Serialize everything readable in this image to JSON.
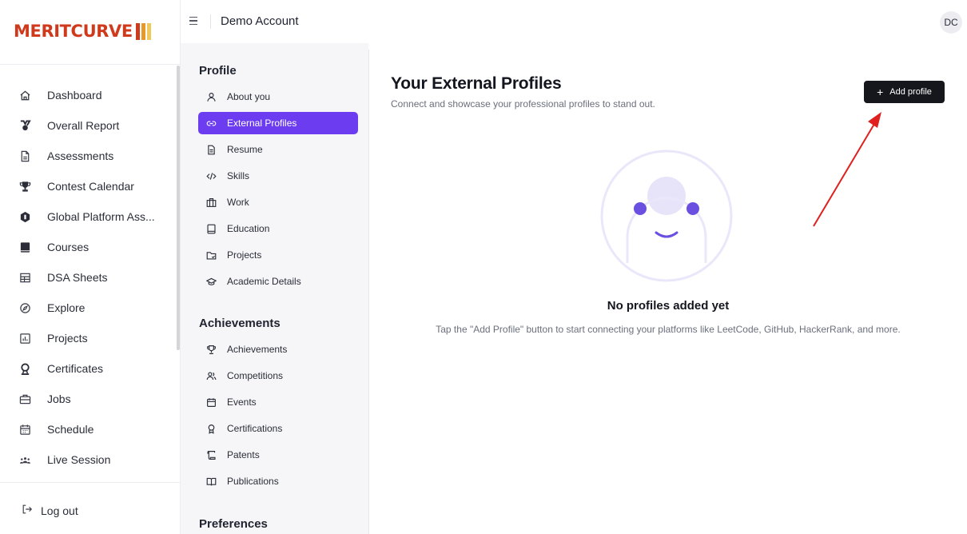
{
  "brand": {
    "name": "MERITCURVE"
  },
  "header": {
    "title": "Demo Account",
    "avatar_initials": "DC"
  },
  "sidebar": {
    "items": [
      {
        "label": "Dashboard",
        "icon": "home-icon"
      },
      {
        "label": "Overall Report",
        "icon": "medal-icon"
      },
      {
        "label": "Assessments",
        "icon": "file-icon"
      },
      {
        "label": "Contest Calendar",
        "icon": "trophy-icon"
      },
      {
        "label": "Global Platform Ass...",
        "icon": "hexagon-icon"
      },
      {
        "label": "Courses",
        "icon": "book-icon"
      },
      {
        "label": "DSA Sheets",
        "icon": "grid-icon"
      },
      {
        "label": "Explore",
        "icon": "compass-icon"
      },
      {
        "label": "Projects",
        "icon": "chart-icon"
      },
      {
        "label": "Certificates",
        "icon": "award-icon"
      },
      {
        "label": "Jobs",
        "icon": "briefcase-icon"
      },
      {
        "label": "Schedule",
        "icon": "calendar-icon"
      },
      {
        "label": "Live Session",
        "icon": "people-icon"
      }
    ],
    "logout_label": "Log out"
  },
  "submenu": {
    "profile_heading": "Profile",
    "profile_items": [
      {
        "label": "About you",
        "icon": "user-icon"
      },
      {
        "label": "External Profiles",
        "icon": "link-icon",
        "active": true
      },
      {
        "label": "Resume",
        "icon": "document-icon"
      },
      {
        "label": "Skills",
        "icon": "code-icon"
      },
      {
        "label": "Work",
        "icon": "briefcase-icon"
      },
      {
        "label": "Education",
        "icon": "book-icon"
      },
      {
        "label": "Projects",
        "icon": "folder-icon"
      },
      {
        "label": "Academic Details",
        "icon": "graduation-cap-icon"
      }
    ],
    "achievements_heading": "Achievements",
    "achievement_items": [
      {
        "label": "Achievements",
        "icon": "trophy-icon"
      },
      {
        "label": "Competitions",
        "icon": "users-icon"
      },
      {
        "label": "Events",
        "icon": "calendar-icon"
      },
      {
        "label": "Certifications",
        "icon": "award-icon"
      },
      {
        "label": "Patents",
        "icon": "scroll-icon"
      },
      {
        "label": "Publications",
        "icon": "open-book-icon"
      }
    ],
    "preferences_heading": "Preferences"
  },
  "main": {
    "title": "Your External Profiles",
    "subtitle": "Connect and showcase your professional profiles to stand out.",
    "add_button_label": "Add profile",
    "empty_title": "No profiles added yet",
    "empty_description": "Tap the \"Add Profile\" button to start connecting your platforms like LeetCode, GitHub, HackerRank, and more."
  },
  "colors": {
    "brand_red": "#cf3a1d",
    "accent_purple": "#6c3df0",
    "button_dark": "#16171c",
    "annotation_arrow": "#e0201e"
  }
}
